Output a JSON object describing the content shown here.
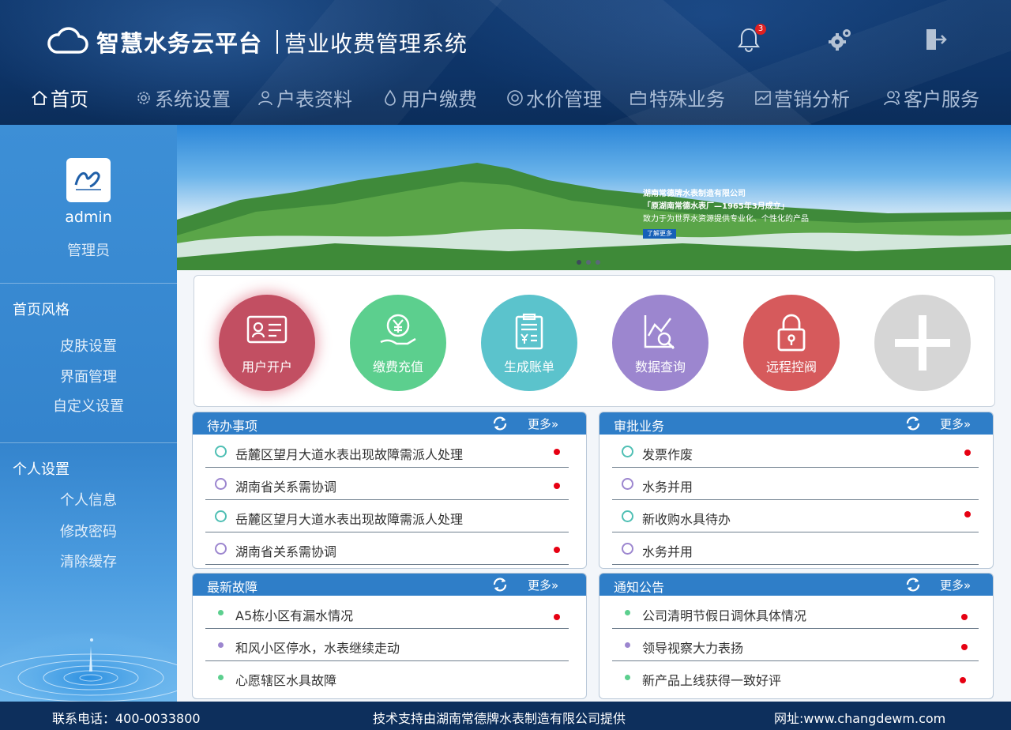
{
  "header": {
    "brand": "智慧水务云平台",
    "subtitle": "营业收费管理系统",
    "notification_count": "3",
    "icons": {
      "notification": "bell-icon",
      "settings": "gears-icon",
      "logout": "exit-icon"
    }
  },
  "nav": [
    {
      "label": "首页",
      "icon": "home-icon"
    },
    {
      "label": "系统设置",
      "icon": "gear-icon"
    },
    {
      "label": "户表资料",
      "icon": "user-icon"
    },
    {
      "label": "用户缴费",
      "icon": "drop-icon"
    },
    {
      "label": "水价管理",
      "icon": "price-icon"
    },
    {
      "label": "特殊业务",
      "icon": "briefcase-icon"
    },
    {
      "label": "营销分析",
      "icon": "chart-icon"
    },
    {
      "label": "客户服务",
      "icon": "users-icon"
    }
  ],
  "sidebar": {
    "username": "admin",
    "role": "管理员",
    "sections": [
      {
        "title": "首页风格",
        "items": [
          "皮肤设置",
          "界面管理",
          "自定义设置"
        ]
      },
      {
        "title": "个人设置",
        "items": [
          "个人信息",
          "修改密码",
          "清除缓存"
        ]
      }
    ]
  },
  "banner": {
    "line1": "湖南常德牌水表制造有限公司",
    "line2": "「原湖南常德水表厂—1965年3月成立」",
    "line3": "致力于为世界水资源提供专业化、个性化的产品",
    "button": "了解更多"
  },
  "quick_actions": [
    {
      "label": "用户开户",
      "color": "#c24f62",
      "icon": "id-card-icon"
    },
    {
      "label": "缴费充值",
      "color": "#5ccf8e",
      "icon": "yuan-hand-icon"
    },
    {
      "label": "生成账单",
      "color": "#5bc3cc",
      "icon": "bill-icon"
    },
    {
      "label": "数据查询",
      "color": "#9c86cf",
      "icon": "chart-search-icon"
    },
    {
      "label": "远程控阀",
      "color": "#d65a5c",
      "icon": "lock-icon"
    },
    {
      "label": "",
      "color": "#d6d6d6",
      "icon": "plus-icon"
    }
  ],
  "panels": {
    "todo": {
      "title": "待办事项",
      "more": "更多»",
      "items": [
        "岳麓区望月大道水表出现故障需派人处理",
        "湖南省关系需协调",
        "岳麓区望月大道水表出现故障需派人处理",
        "湖南省关系需协调"
      ]
    },
    "approval": {
      "title": "审批业务",
      "more": "更多»",
      "items": [
        "发票作废",
        "水务并用",
        "新收购水具待办",
        "水务并用"
      ]
    },
    "faults": {
      "title": "最新故障",
      "more": "更多»",
      "items": [
        "A5栋小区有漏水情况",
        "和风小区停水，水表继续走动",
        "心愿辖区水具故障"
      ]
    },
    "notices": {
      "title": "通知公告",
      "more": "更多»",
      "items": [
        "公司清明节假日调休具体情况",
        "领导视察大力表扬",
        "新产品上线获得一致好评"
      ]
    }
  },
  "footer": {
    "phone": "联系电话：400-0033800",
    "support": "技术支持由湖南常德牌水表制造有限公司提供",
    "website": "网址:www.changdewm.com"
  },
  "colors": {
    "header": "#0d3366",
    "sidebar": "#3484cd",
    "panel_head": "#2f7ec8",
    "footer": "#0d2f5c",
    "alert_dot": "#e60012"
  }
}
